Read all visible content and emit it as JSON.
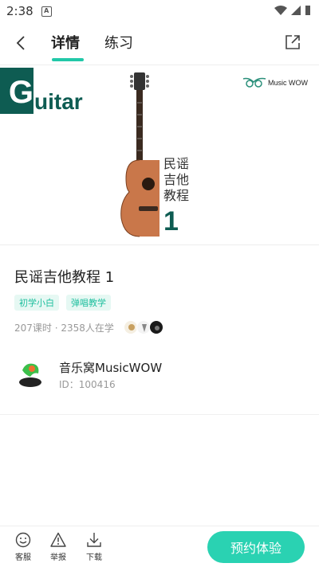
{
  "status_bar": {
    "time": "2:38",
    "badge": "A"
  },
  "nav": {
    "tabs": [
      {
        "label": "详情"
      },
      {
        "label": "练习"
      }
    ]
  },
  "banner": {
    "guitar_letter": "G",
    "guitar_rest": "uitar",
    "brand": "Music WOW",
    "vertical_title": [
      "民谣",
      "吉他",
      "教程"
    ],
    "number": "1"
  },
  "course": {
    "title": "民谣吉他教程 1",
    "tags": [
      "初学小白",
      "弹唱教学"
    ],
    "meta": "207课时 · 2358人在学"
  },
  "author": {
    "name": "音乐窝MusicWOW",
    "id": "ID：100416"
  },
  "bottom_bar": {
    "service_label": "客服",
    "report_label": "举报",
    "download_label": "下载",
    "cta_label": "预约体验"
  },
  "colors": {
    "accent": "#2ad2b2",
    "brand_dark": "#0e5c52"
  }
}
